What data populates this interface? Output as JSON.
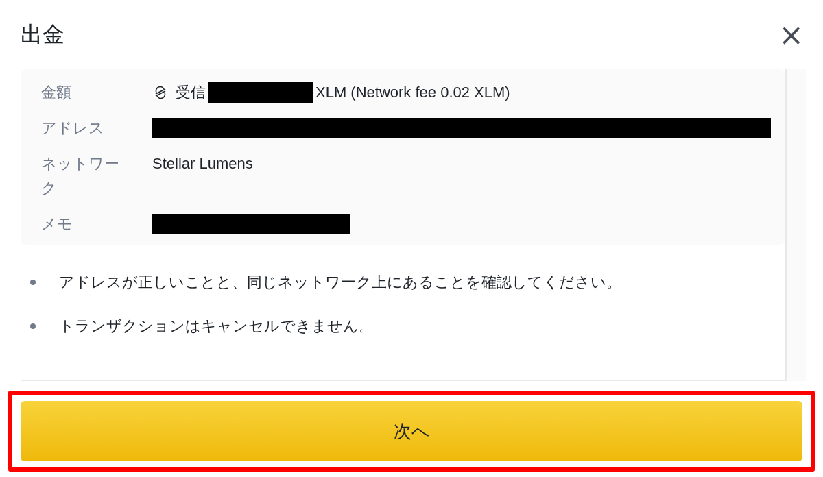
{
  "dialog": {
    "title": "出金",
    "close": "×"
  },
  "details": [
    {
      "label": "金額",
      "parts": [
        {
          "kind": "icon"
        },
        {
          "kind": "text",
          "text": "受信"
        },
        {
          "kind": "redacted"
        },
        {
          "kind": "text",
          "text": "XLM (Network fee 0.02 XLM)"
        }
      ]
    },
    {
      "label": "アドレス",
      "parts": [
        {
          "kind": "redacted"
        }
      ]
    },
    {
      "label": "ネットワーク",
      "parts": [
        {
          "kind": "text",
          "text": "Stellar Lumens"
        }
      ]
    },
    {
      "label": "メモ",
      "parts": [
        {
          "kind": "redacted"
        }
      ]
    }
  ],
  "notes": [
    "アドレスが正しいことと、同じネットワーク上にあることを確認してください。",
    "トランザクションはキャンセルできません。"
  ],
  "button": {
    "label": "次へ",
    "highlighted": true
  }
}
